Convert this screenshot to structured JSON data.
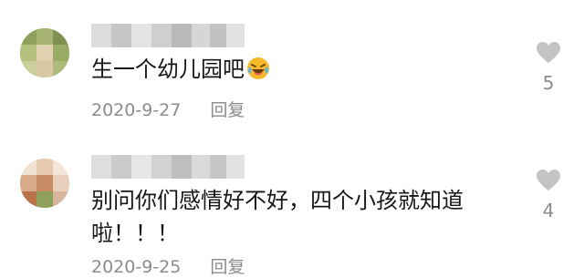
{
  "comments": [
    {
      "text_lines": [
        "生一个幼儿园吧"
      ],
      "emoji_icon": "laughing-crying-face-icon",
      "date": "2020-9-27",
      "reply_label": "回复",
      "like_count": "5"
    },
    {
      "text_lines": [
        "别问你们感情好不好，四个小孩就知道",
        "啦！！！"
      ],
      "date": "2020-9-25",
      "reply_label": "回复",
      "like_count": "4"
    }
  ],
  "colors": {
    "text": "#161616",
    "meta": "#8c8c8c",
    "heart_outline": "#c4c4c4",
    "emoji_face": "#f7b928"
  }
}
